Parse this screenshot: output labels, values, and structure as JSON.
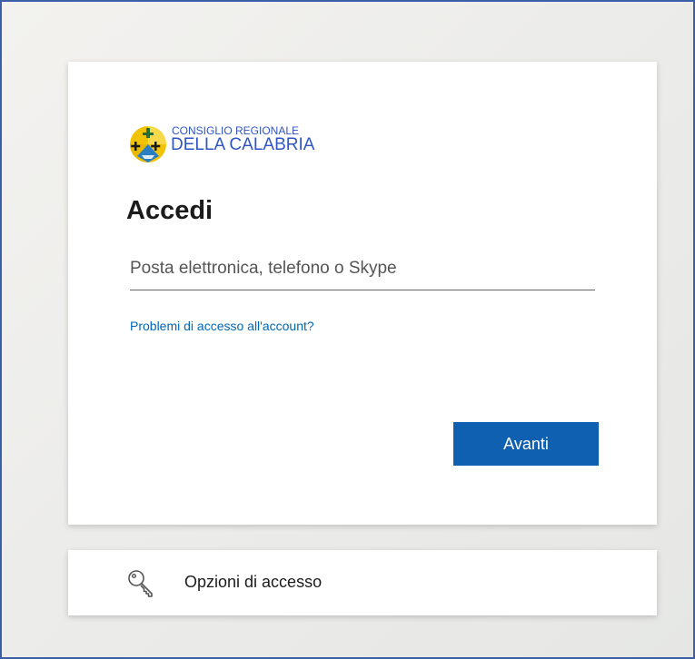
{
  "login": {
    "logo": {
      "line1": "CONSIGLIO REGIONALE",
      "line2": "DELLA CALABRIA"
    },
    "title": "Accedi",
    "email_placeholder": "Posta elettronica, telefono o Skype",
    "email_value": "",
    "help_link": "Problemi di accesso all'account?",
    "next_button": "Avanti"
  },
  "options": {
    "label": "Opzioni di accesso",
    "icon": "key-icon"
  },
  "colors": {
    "accent_button": "#0f60b1",
    "link": "#0067b8",
    "logo_blue": "#2f55c4",
    "emblem_yellow": "#f2c300"
  }
}
